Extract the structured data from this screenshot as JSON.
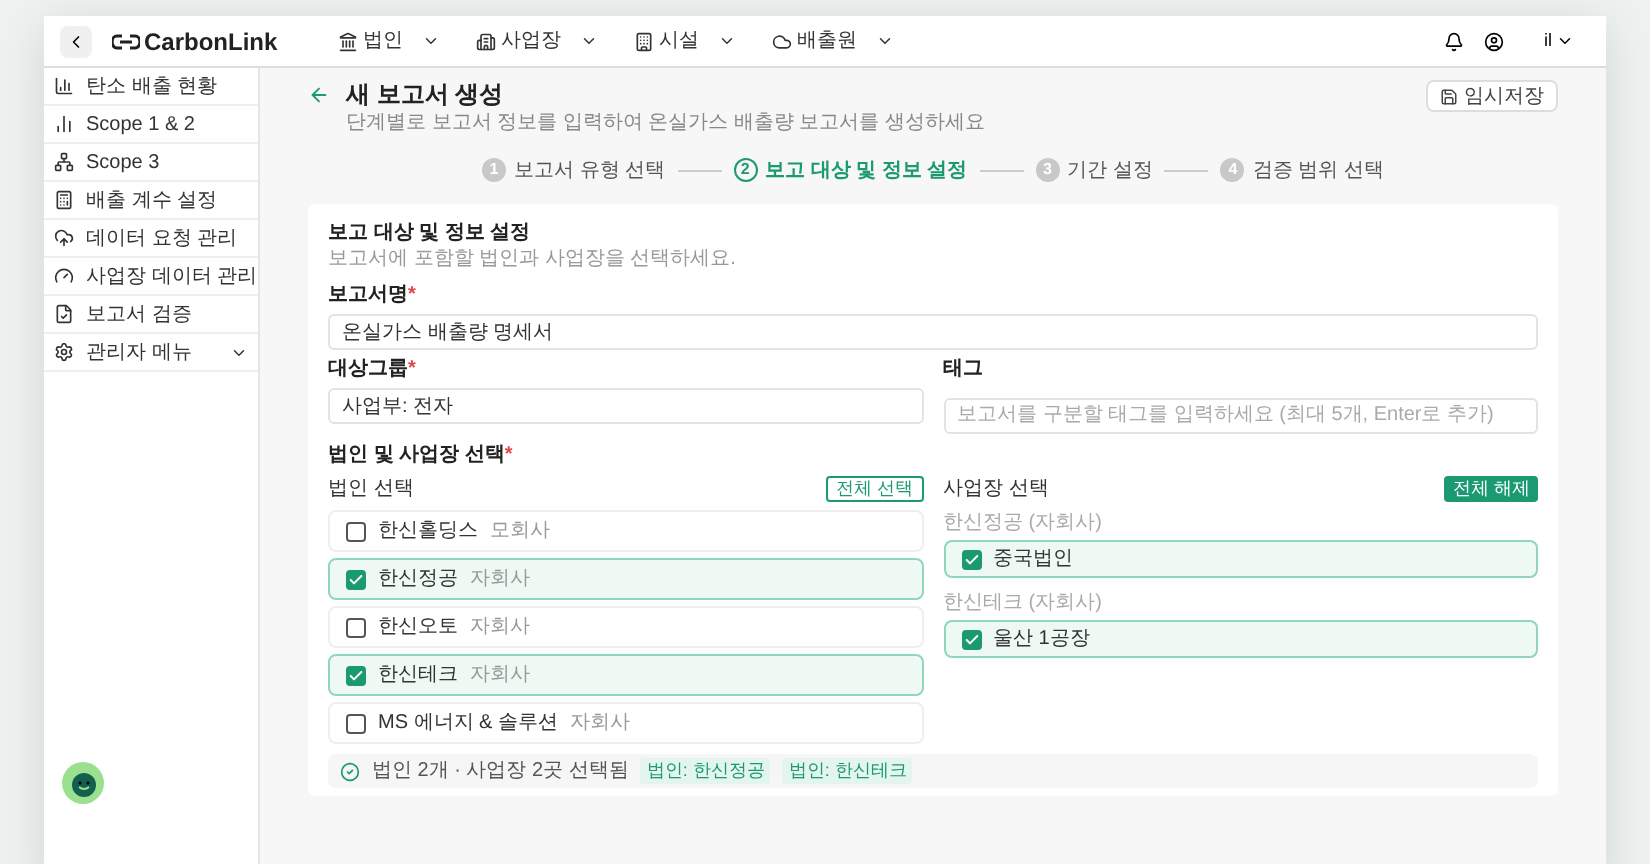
{
  "topbar": {
    "logo": "CarbonLink",
    "nav": [
      {
        "label": "법인",
        "kind": "corp"
      },
      {
        "label": "사업장",
        "kind": "site"
      },
      {
        "label": "시설",
        "kind": "facility"
      },
      {
        "label": "배출원",
        "kind": "source"
      }
    ],
    "user": "il"
  },
  "sidebar": {
    "items": [
      {
        "label": "탄소 배출 현황",
        "kind": "link"
      },
      {
        "label": "Scope 1 & 2",
        "kind": "link"
      },
      {
        "label": "Scope 3",
        "kind": "link"
      },
      {
        "label": "배출 계수 설정",
        "kind": "link"
      },
      {
        "label": "데이터 요청 관리",
        "kind": "link"
      },
      {
        "label": "사업장 데이터 관리",
        "kind": "link"
      },
      {
        "label": "보고서 검증",
        "kind": "link"
      },
      {
        "label": "관리자 메뉴",
        "kind": "group"
      }
    ]
  },
  "page": {
    "title": "새 보고서 생성",
    "subtitle": "단계별로 보고서 정보를 입력하여 온실가스 배출량 보고서를 생성하세요",
    "save_button": "임시저장"
  },
  "steps": [
    {
      "number": "1",
      "label": "보고서 유형 선택",
      "selected": false
    },
    {
      "number": "2",
      "label": "보고 대상 및 정보 설정",
      "selected": true
    },
    {
      "number": "3",
      "label": "기간 설정",
      "selected": false
    },
    {
      "number": "4",
      "label": "검증 범위 선택",
      "selected": false
    }
  ],
  "form": {
    "title": "보고 대상 및 정보 설정",
    "description": "보고서에 포함할 법인과 사업장을 선택하세요.",
    "report_name": {
      "label": "보고서명",
      "required_mark": "*",
      "value": "온실가스 배출량 명세서"
    },
    "target_group": {
      "label": "대상그룹",
      "required_mark": "*",
      "value": "사업부: 전자"
    },
    "tags": {
      "label": "태그",
      "placeholder": "보고서를 구분할 태그를 입력하세요 (최대 5개, Enter로 추가)"
    },
    "selection_label": {
      "label": "법인 및 사업장 선택",
      "required_mark": "*"
    },
    "corporations": {
      "title": "법인 선택",
      "button": "전체 선택",
      "items": [
        {
          "name": "한신홀딩스",
          "type": "모회사",
          "checked": false
        },
        {
          "name": "한신정공",
          "type": "자회사",
          "checked": true
        },
        {
          "name": "한신오토",
          "type": "자회사",
          "checked": false
        },
        {
          "name": "한신테크",
          "type": "자회사",
          "checked": true
        },
        {
          "name": "MS 에너지 & 솔루션",
          "type": "자회사",
          "checked": false
        }
      ]
    },
    "sites": {
      "title": "사업장 선택",
      "button": "전체 해제",
      "groups": [
        {
          "label": "한신정공 (자회사)",
          "items": [
            {
              "name": "중국법인",
              "checked": true
            }
          ]
        },
        {
          "label": "한신테크 (자회사)",
          "items": [
            {
              "name": "울산 1공장",
              "checked": true
            }
          ]
        }
      ]
    },
    "summary": {
      "text": "법인 2개 · 사업장 2곳 선택됨",
      "chips": [
        "법인: 한신정공",
        "법인: 한신테크"
      ]
    }
  }
}
